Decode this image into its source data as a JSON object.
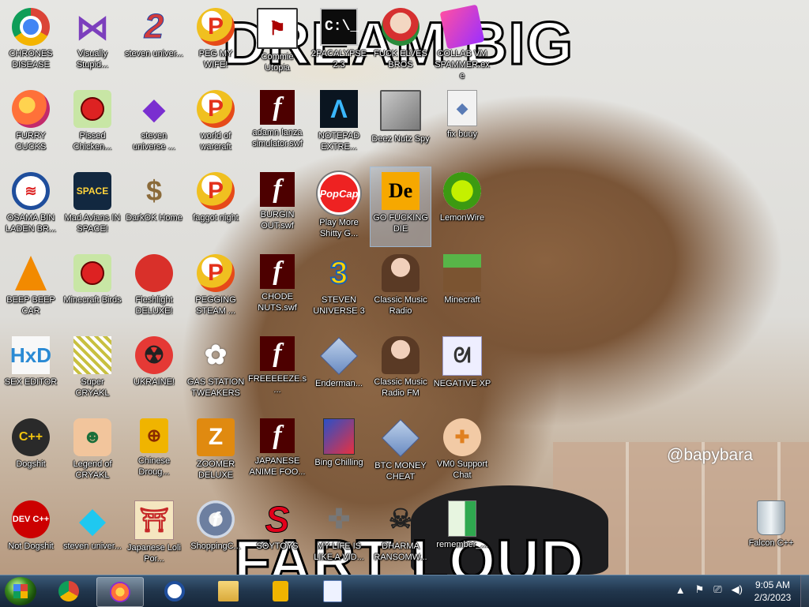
{
  "wallpaper": {
    "caption_top": "DREAM BIG",
    "caption_bottom": "FART LOUD",
    "watermark": "@bapybara"
  },
  "icons": [
    {
      "label": "CHRONES DISEASE",
      "icon": "chrome-icon",
      "kind": "g-chrome",
      "glyph": ""
    },
    {
      "label": "Visually Stupid...",
      "icon": "visual-studio-icon",
      "kind": "g-vs",
      "glyph": "⋈"
    },
    {
      "label": "steven univer...",
      "icon": "number-two-icon",
      "kind": "g-two",
      "glyph": "2"
    },
    {
      "label": "PEG MY WIFE!",
      "icon": "popcap-peggle-icon",
      "kind": "g-p",
      "glyph": "P"
    },
    {
      "label": "Commie Utopia",
      "icon": "red-flag-icon",
      "kind": "g-flag",
      "glyph": "⚑"
    },
    {
      "label": "2PACALYPSE 2.3",
      "icon": "command-prompt-icon",
      "kind": "g-cmd",
      "glyph": "C:\\_"
    },
    {
      "label": "FUCK ELVES BROS",
      "icon": "elf-icon",
      "kind": "g-elf",
      "glyph": ""
    },
    {
      "label": "COLLAB VM SPAMMER.exe",
      "icon": "tape-icon",
      "kind": "g-tape",
      "glyph": ""
    },
    {
      "label": "FURRY CUCKS",
      "icon": "firefox-icon",
      "kind": "g-ff",
      "glyph": ""
    },
    {
      "label": "Pissed Chicken...",
      "icon": "angry-birds-seasons-icon",
      "kind": "g-bird",
      "glyph": ""
    },
    {
      "label": "steven universe ...",
      "icon": "gem-icon",
      "kind": "g-gem",
      "glyph": "◆"
    },
    {
      "label": "world of warcraft",
      "icon": "popcap-peggle-icon",
      "kind": "g-p",
      "glyph": "P"
    },
    {
      "label": "adamn lanza simulator.swf",
      "icon": "flash-swf-icon",
      "kind": "g-swf",
      "glyph": "f"
    },
    {
      "label": "NOTEPAD EXTRE...",
      "icon": "notepad-extreme-icon",
      "kind": "g-notepad",
      "glyph": "Λ"
    },
    {
      "label": "Deez Nutz Spy",
      "icon": "windows-stack-icon",
      "kind": "g-windows",
      "glyph": ""
    },
    {
      "label": "fix buuy",
      "icon": "file-icon",
      "kind": "g-file",
      "glyph": "◆"
    },
    {
      "label": "OSAMA BIN LADEN BR...",
      "icon": "obama-logo-icon",
      "kind": "g-obama",
      "glyph": "≋"
    },
    {
      "label": "Mad Avians IN SPACE!",
      "icon": "angry-birds-space-icon",
      "kind": "g-space",
      "glyph": "SPACE"
    },
    {
      "label": "DarkOK Home",
      "icon": "money-bag-icon",
      "kind": "g-money",
      "glyph": "$"
    },
    {
      "label": "faggot night",
      "icon": "popcap-peggle-icon",
      "kind": "g-p",
      "glyph": "P"
    },
    {
      "label": "BURGIN OUT.swf",
      "icon": "flash-swf-icon",
      "kind": "g-swf",
      "glyph": "f"
    },
    {
      "label": "Play More Shitty G...",
      "icon": "popcap-logo-icon",
      "kind": "g-popcap",
      "glyph": "PopCap"
    },
    {
      "label": "GO FUCKING DIE",
      "icon": "de-logo-icon",
      "kind": "g-de",
      "glyph": "De"
    },
    {
      "label": "LemonWire",
      "icon": "limewire-icon",
      "kind": "g-lime",
      "glyph": ""
    },
    {
      "label": "BEEP BEEP CAR",
      "icon": "vlc-cone-icon",
      "kind": "g-cone",
      "glyph": ""
    },
    {
      "label": "Minecraft Birds",
      "icon": "angry-bird-icon",
      "kind": "g-bird",
      "glyph": ""
    },
    {
      "label": "Fleshlight DELUXE!",
      "icon": "red-fuzzball-icon",
      "kind": "g-red",
      "glyph": ""
    },
    {
      "label": "PEGGING STEAM ...",
      "icon": "popcap-peggle-icon",
      "kind": "g-p",
      "glyph": "P"
    },
    {
      "label": "CHODE NUTS.swf",
      "icon": "flash-swf-icon",
      "kind": "g-swf",
      "glyph": "f"
    },
    {
      "label": "STEVEN UNIVERSE 3",
      "icon": "number-three-icon",
      "kind": "g-steam3",
      "glyph": "3"
    },
    {
      "label": "Classic Music Radio",
      "icon": "portrait-lady-icon",
      "kind": "g-lady",
      "glyph": ""
    },
    {
      "label": "Minecraft",
      "icon": "grass-block-icon",
      "kind": "g-grass",
      "glyph": ""
    },
    {
      "label": "SEX EDITOR",
      "icon": "hxd-icon",
      "kind": "g-hxd",
      "glyph": "HxD"
    },
    {
      "label": "Super CRYAKL",
      "icon": "pixel-art-icon",
      "kind": "g-pixel",
      "glyph": ""
    },
    {
      "label": "UKRAINE!",
      "icon": "radiation-icon",
      "kind": "g-rad",
      "glyph": "☢"
    },
    {
      "label": "GAS STATION TWEAKERS",
      "icon": "flower-icon",
      "kind": "g-flower",
      "glyph": "✿"
    },
    {
      "label": "FREEEEEZE.s...",
      "icon": "flash-swf-icon",
      "kind": "g-swf",
      "glyph": "f"
    },
    {
      "label": "Enderman...",
      "icon": "diamond-file-icon",
      "kind": "g-dia",
      "glyph": ""
    },
    {
      "label": "Classic Music Radio FM",
      "icon": "portrait-lady-icon",
      "kind": "g-lady",
      "glyph": ""
    },
    {
      "label": "NEGATIVE XP",
      "icon": "bunny-icon",
      "kind": "g-bunny",
      "glyph": "ᘛ"
    },
    {
      "label": "Dogshit",
      "icon": "dev-cpp-icon",
      "kind": "g-dog",
      "glyph": "C++"
    },
    {
      "label": "Legend of CRYAKL",
      "icon": "pirate-character-icon",
      "kind": "g-pirate",
      "glyph": "☻"
    },
    {
      "label": "Chinese Droug...",
      "icon": "mahjong-tile-icon",
      "kind": "g-mahjong",
      "glyph": "⊕"
    },
    {
      "label": "ZOOMER DELUXE",
      "icon": "zuma-icon",
      "kind": "g-zoom",
      "glyph": "Z"
    },
    {
      "label": "JAPANESE ANIME FOO...",
      "icon": "flash-swf-icon",
      "kind": "g-swf",
      "glyph": "f"
    },
    {
      "label": "Bing Chilling",
      "icon": "software-box-icon",
      "kind": "g-box",
      "glyph": ""
    },
    {
      "label": "BTC MONEY CHEAT",
      "icon": "diamond-file-icon",
      "kind": "g-dia",
      "glyph": ""
    },
    {
      "label": "VM0 Support Chat",
      "icon": "doctor-icon",
      "kind": "g-doctor",
      "glyph": "✚"
    },
    {
      "label": "Not Dogshit",
      "icon": "dev-cpp-icon",
      "kind": "g-devc",
      "glyph": "DEV C++"
    },
    {
      "label": "steven univer...",
      "icon": "diamond-gem-icon",
      "kind": "g-cyan",
      "glyph": "◆"
    },
    {
      "label": "Japanese Loli Por...",
      "icon": "torii-gate-icon",
      "kind": "g-gate",
      "glyph": "⛩"
    },
    {
      "label": "ShoppingC...",
      "icon": "flash-player-icon",
      "kind": "g-shop",
      "glyph": "f"
    },
    {
      "label": "SOYTOYS",
      "icon": "red-s-icon",
      "kind": "g-s",
      "glyph": "S"
    },
    {
      "label": "MY LIFE IS LIKE A VID...",
      "icon": "gamepad-icon",
      "kind": "g-pad",
      "glyph": "✜"
    },
    {
      "label": "DHARMA RANSOMW...",
      "icon": "skull-icon",
      "kind": "g-skull",
      "glyph": "☠"
    },
    {
      "label": "remember_...",
      "icon": "green-file-icon",
      "kind": "g-green",
      "glyph": ""
    },
    {
      "label": "Falcon C++",
      "icon": "recycle-bin-icon",
      "kind": "g-trash",
      "glyph": ""
    }
  ],
  "taskbar": {
    "buttons": [
      {
        "name": "taskbar-chrome",
        "icon": "chrome-icon",
        "cls": "m-chrome"
      },
      {
        "name": "taskbar-firefox",
        "icon": "firefox-icon",
        "cls": "m-ff"
      },
      {
        "name": "taskbar-obama",
        "icon": "obama-logo-icon",
        "cls": "m-obama"
      },
      {
        "name": "taskbar-explorer",
        "icon": "folder-icon",
        "cls": "m-folder"
      },
      {
        "name": "taskbar-mahjong",
        "icon": "mahjong-tile-icon",
        "cls": "m-mahjong"
      },
      {
        "name": "taskbar-wordpad",
        "icon": "document-icon",
        "cls": "m-note"
      }
    ],
    "tray_icons": [
      "show-hidden-icons-icon",
      "flag-icon",
      "network-icon",
      "volume-icon"
    ],
    "clock": {
      "time": "9:05 AM",
      "date": "2/3/2023"
    }
  }
}
